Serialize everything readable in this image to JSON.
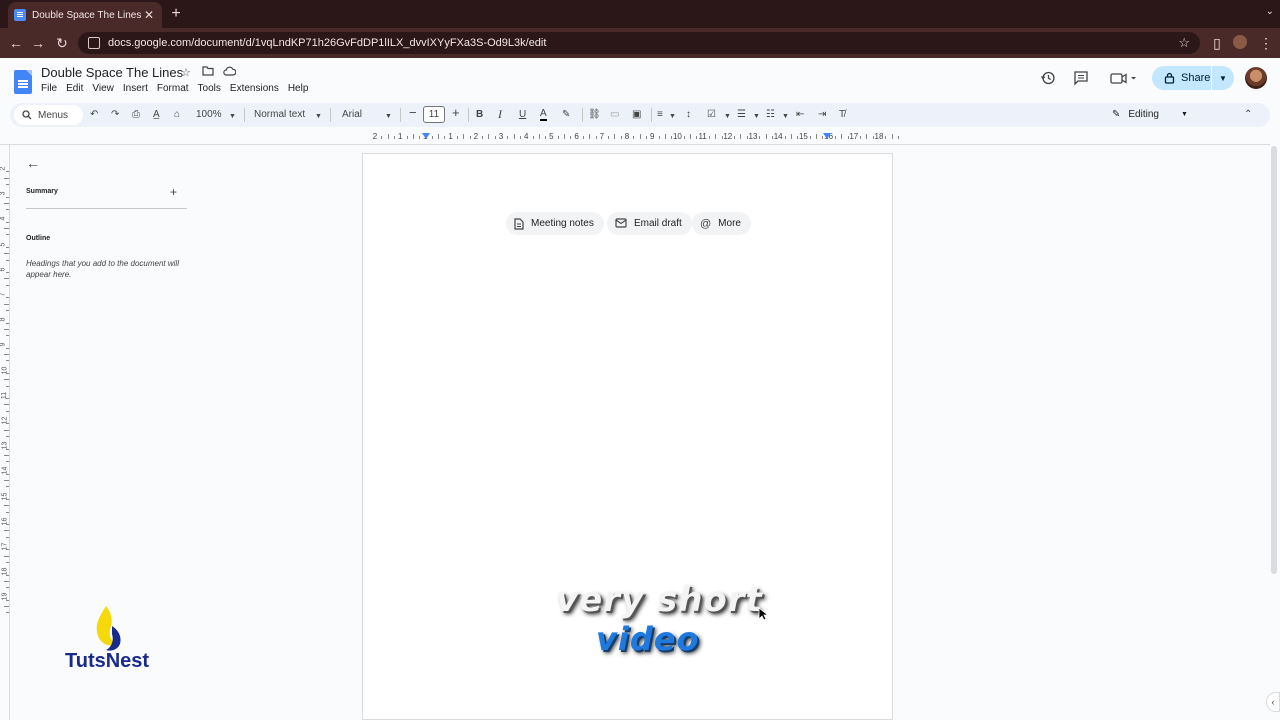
{
  "browser": {
    "tab_title": "Double Space The Lines - Go",
    "tab_close": "✕",
    "new_tab": "+",
    "url": "docs.google.com/document/d/1vqLndKP71h26GvFdDP1lILX_dvvIXYyFXa3S-Od9L3k/edit"
  },
  "doc": {
    "title": "Double Space The Lines",
    "menus": [
      "File",
      "Edit",
      "View",
      "Insert",
      "Format",
      "Tools",
      "Extensions",
      "Help"
    ],
    "share_label": "Share"
  },
  "toolbar": {
    "search_placeholder": "Menus",
    "zoom": "100%",
    "style": "Normal text",
    "font": "Arial",
    "font_size": "11",
    "mode": "Editing"
  },
  "ruler": {
    "numbers": [
      "2",
      "1",
      "1",
      "1",
      "2",
      "3",
      "4",
      "5",
      "6",
      "7",
      "8",
      "9",
      "10",
      "11",
      "12",
      "13",
      "14",
      "15",
      "16",
      "17",
      "18"
    ],
    "vertical_numbers": [
      "2",
      "3",
      "4",
      "5",
      "6",
      "7",
      "8",
      "9",
      "10",
      "11",
      "12",
      "13",
      "14",
      "15",
      "16",
      "17",
      "18",
      "19"
    ]
  },
  "outline_panel": {
    "summary_label": "Summary",
    "outline_label": "Outline",
    "outline_empty": "Headings that you add to the document will appear here."
  },
  "page": {
    "chips": [
      {
        "label": "Meeting notes",
        "icon": "document-icon"
      },
      {
        "label": "Email draft",
        "icon": "email-icon"
      },
      {
        "label": "More",
        "icon": "at-icon"
      }
    ]
  },
  "overlay": {
    "line1": "very short",
    "line2": "video",
    "brand": "TutsNest"
  },
  "colors": {
    "tab_bar": "#2b1717",
    "share_bg": "#c2e7ff",
    "docs_blue": "#4285f4",
    "overlay_blue": "#1f7ae0",
    "brand_navy": "#1a2a8a"
  }
}
